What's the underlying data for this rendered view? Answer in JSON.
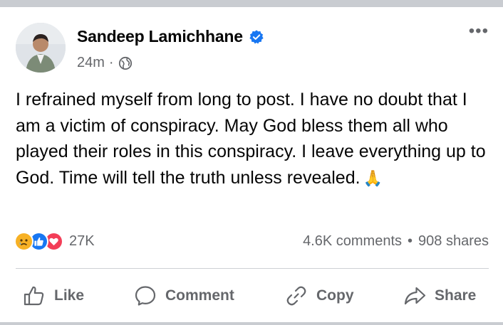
{
  "post": {
    "author": "Sandeep Lamichhane",
    "time": "24m",
    "time_sep": "·",
    "text": "I refrained myself from long to post. I have no doubt that I am a victim of conspiracy. May God bless them all who played their roles in this conspiracy. I leave everything up to God. Time will tell the truth unless revealed.",
    "emoji": "🙏",
    "more_label": "•••"
  },
  "stats": {
    "reactions_count": "27K",
    "comments": "4.6K comments",
    "sep": "•",
    "shares": "908 shares",
    "reaction_icons": [
      "sad-icon",
      "like-icon",
      "love-icon"
    ]
  },
  "actions": {
    "like": "Like",
    "comment": "Comment",
    "copy": "Copy",
    "share": "Share"
  },
  "colors": {
    "verified": "#1877f2",
    "like": "#1877f2",
    "love": "#f33e58",
    "sad": "#f7b125",
    "secondary_text": "#65676b"
  }
}
